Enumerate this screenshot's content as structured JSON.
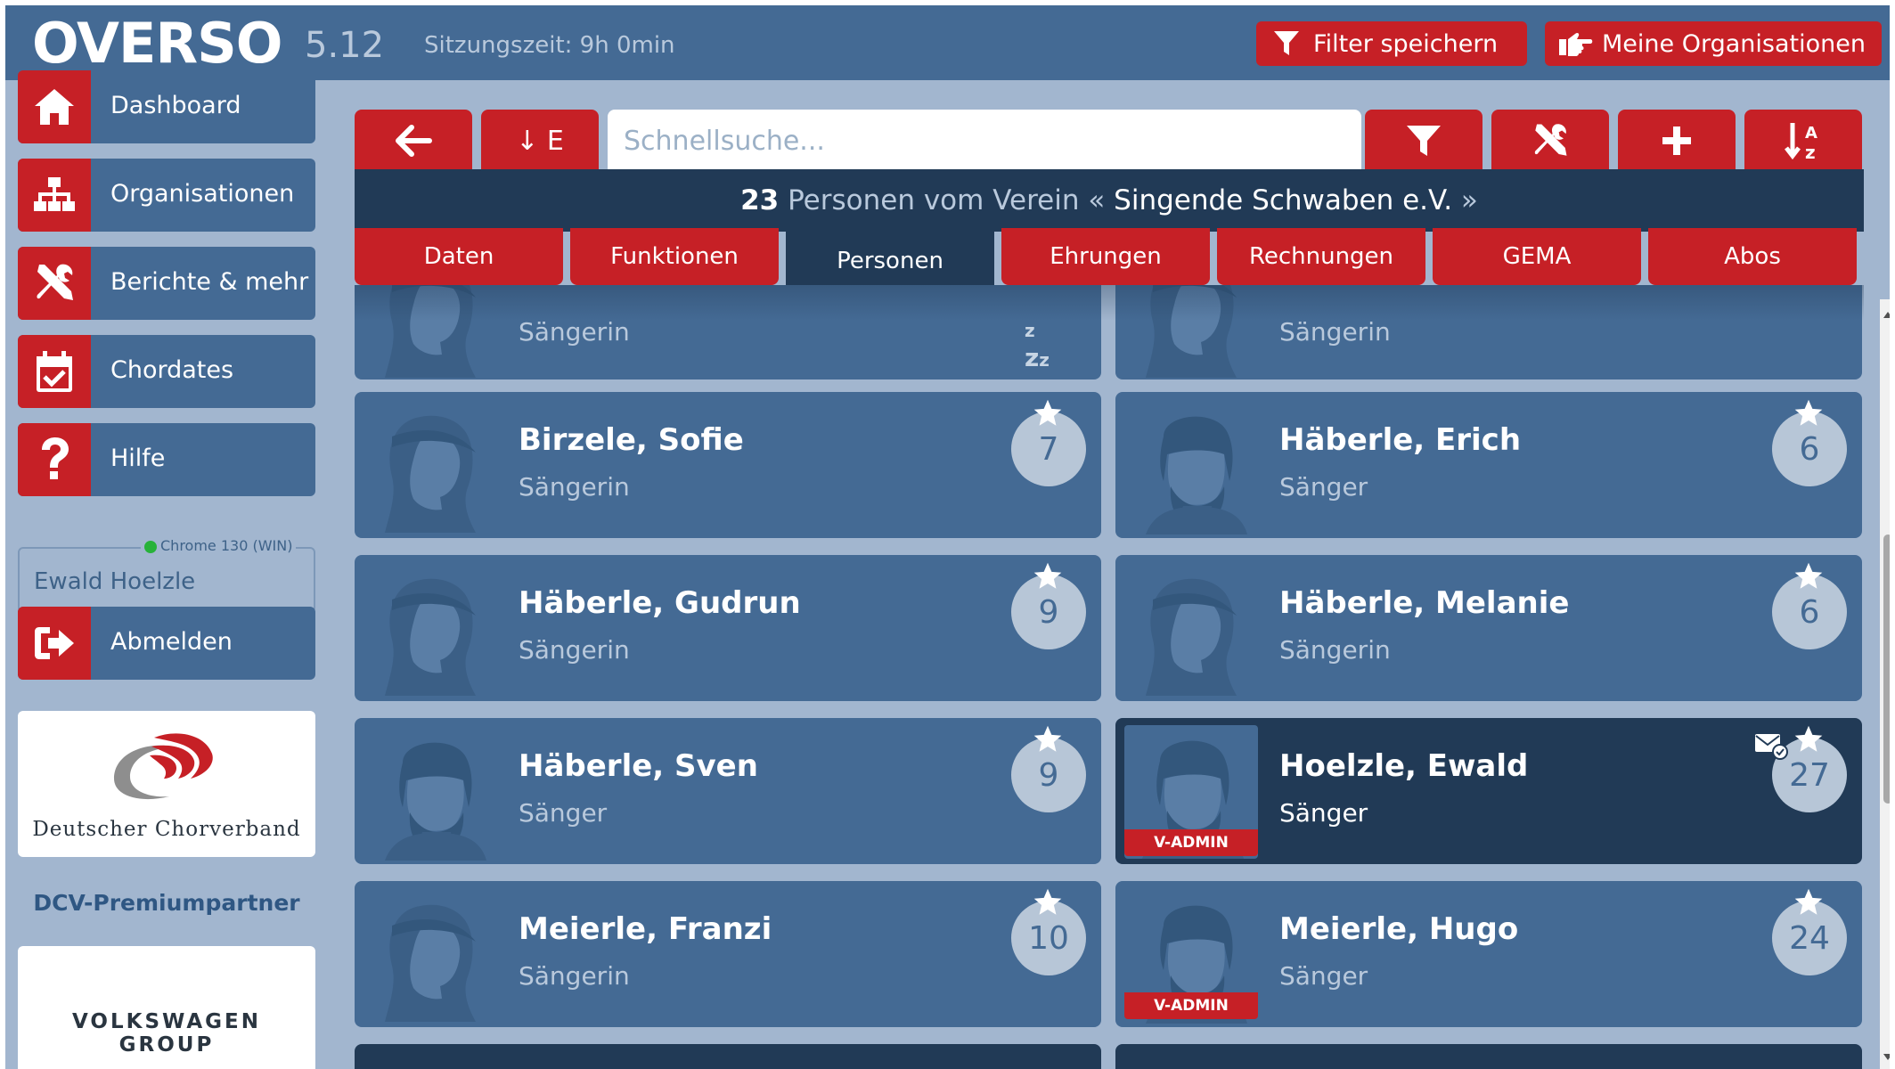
{
  "header": {
    "logo": "OVERSO",
    "version": "5.12",
    "session": "Sitzungszeit: 9h 0min",
    "filter_button": "Filter speichern",
    "org_button": "Meine Organisationen"
  },
  "sidebar": {
    "items": [
      {
        "label": "Dashboard",
        "icon": "home-icon"
      },
      {
        "label": "Organisationen",
        "icon": "sitemap-icon"
      },
      {
        "label": "Berichte & mehr",
        "icon": "tools-icon"
      },
      {
        "label": "Chordates",
        "icon": "calendar-check-icon"
      },
      {
        "label": "Hilfe",
        "icon": "question-icon"
      }
    ],
    "browser": "Chrome 130 (WIN)",
    "user": "Ewald Hoelzle",
    "logout": "Abmelden",
    "sponsor1": "Deutscher Chorverband",
    "partner_label": "DCV-Premiumpartner",
    "sponsor2": "VOLKSWAGEN GROUP"
  },
  "toolbar": {
    "sort_label": "↓ E",
    "search_placeholder": "Schnellsuche..."
  },
  "info": {
    "count": "23",
    "text": "Personen vom Verein «",
    "verein": "Singende Schwaben e.V.",
    "close": "»"
  },
  "tabs": [
    "Daten",
    "Funktionen",
    "Personen",
    "Ehrungen",
    "Rechnungen",
    "GEMA",
    "Abos"
  ],
  "active_tab": "Personen",
  "partial_row": {
    "left_role": "Sängerin",
    "right_role": "Sängerin"
  },
  "persons": [
    {
      "name": "Birzele, Sofie",
      "role": "Sängerin",
      "count": "7"
    },
    {
      "name": "Häberle, Erich",
      "role": "Sänger",
      "count": "6"
    },
    {
      "name": "Häberle, Gudrun",
      "role": "Sängerin",
      "count": "9"
    },
    {
      "name": "Häberle, Melanie",
      "role": "Sängerin",
      "count": "6"
    },
    {
      "name": "Häberle, Sven",
      "role": "Sänger",
      "count": "9"
    },
    {
      "name": "Hoelzle, Ewald",
      "role": "Sänger",
      "count": "27",
      "badge": "V-ADMIN"
    },
    {
      "name": "Meierle, Franzi",
      "role": "Sängerin",
      "count": "10"
    },
    {
      "name": "Meierle, Hugo",
      "role": "Sänger",
      "count": "24",
      "badge": "V-ADMIN"
    }
  ],
  "colors": {
    "accent": "#c62026",
    "panel": "#446a94",
    "dark": "#213a56",
    "background": "#a2b6cf"
  }
}
